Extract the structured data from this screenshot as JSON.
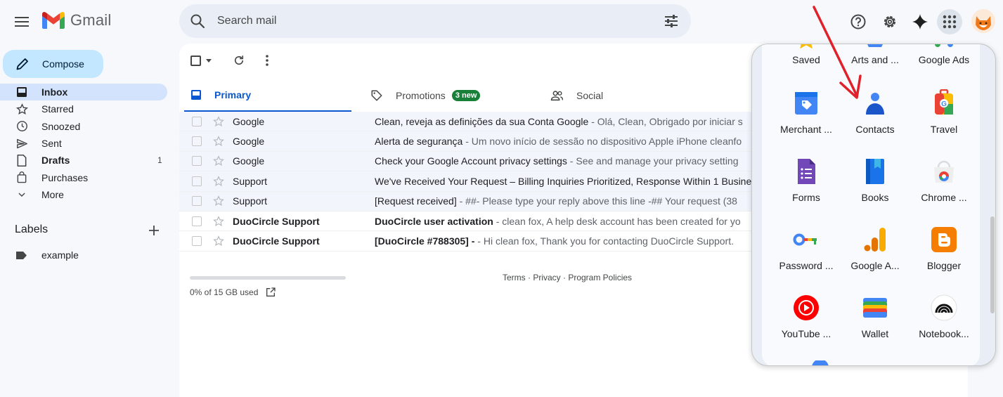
{
  "app": {
    "name": "Gmail"
  },
  "search": {
    "placeholder": "Search mail"
  },
  "compose": {
    "label": "Compose"
  },
  "nav": [
    {
      "label": "Inbox",
      "count": ""
    },
    {
      "label": "Starred",
      "count": ""
    },
    {
      "label": "Snoozed",
      "count": ""
    },
    {
      "label": "Sent",
      "count": ""
    },
    {
      "label": "Drafts",
      "count": "1"
    },
    {
      "label": "Purchases",
      "count": ""
    },
    {
      "label": "More",
      "count": ""
    }
  ],
  "labels": {
    "title": "Labels",
    "items": [
      "example"
    ]
  },
  "tabs": [
    {
      "label": "Primary"
    },
    {
      "label": "Promotions",
      "badge": "3 new"
    },
    {
      "label": "Social"
    }
  ],
  "emails": [
    {
      "sender": "Google",
      "subject": "Clean, reveja as definições da sua Conta Google",
      "snippet": " - Olá, Clean, Obrigado por iniciar s"
    },
    {
      "sender": "Google",
      "subject": "Alerta de segurança",
      "snippet": " - Um novo início de sessão no dispositivo Apple iPhone cleanfo"
    },
    {
      "sender": "Google",
      "subject": "Check your Google Account privacy settings",
      "snippet": " - See and manage your privacy setting"
    },
    {
      "sender": "Support",
      "subject": "We've Received Your Request – Billing Inquiries Prioritized, Response Within 1 Busine",
      "snippet": ""
    },
    {
      "sender": "Support",
      "subject": "[Request received]",
      "snippet": " - ##- Please type your reply above this line -## Your request (38"
    },
    {
      "sender": "DuoCircle Support",
      "subject": "DuoCircle user activation",
      "snippet": " - clean fox, A help desk account has been created for yo"
    },
    {
      "sender": "DuoCircle Support",
      "subject": "[DuoCircle #788305] -",
      "snippet": " - Hi clean fox, Thank you for contacting DuoCircle Support."
    }
  ],
  "storage": {
    "text": "0% of 15 GB used",
    "used_fraction": 0
  },
  "footer": {
    "links": "Terms · Privacy · Program Policies"
  },
  "apps": [
    {
      "label": "Saved",
      "icon": "saved-icon"
    },
    {
      "label": "Arts and ...",
      "icon": "arts-and-culture-icon"
    },
    {
      "label": "Google Ads",
      "icon": "google-ads-icon"
    },
    {
      "label": "Merchant ...",
      "icon": "merchant-center-icon"
    },
    {
      "label": "Contacts",
      "icon": "contacts-icon"
    },
    {
      "label": "Travel",
      "icon": "travel-icon"
    },
    {
      "label": "Forms",
      "icon": "forms-icon"
    },
    {
      "label": "Books",
      "icon": "books-icon"
    },
    {
      "label": "Chrome ...",
      "icon": "chrome-web-store-icon"
    },
    {
      "label": "Password ...",
      "icon": "password-manager-icon"
    },
    {
      "label": "Google A...",
      "icon": "google-analytics-icon"
    },
    {
      "label": "Blogger",
      "icon": "blogger-icon"
    },
    {
      "label": "YouTube ...",
      "icon": "youtube-music-icon"
    },
    {
      "label": "Wallet",
      "icon": "wallet-icon"
    },
    {
      "label": "Notebook...",
      "icon": "notebooklm-icon"
    }
  ],
  "colors": {
    "accent": "#0b57d0",
    "compose_bg": "#c2e7ff",
    "active_nav": "#d3e3fd",
    "badge": "#188038",
    "arrow": "#e0202a"
  }
}
